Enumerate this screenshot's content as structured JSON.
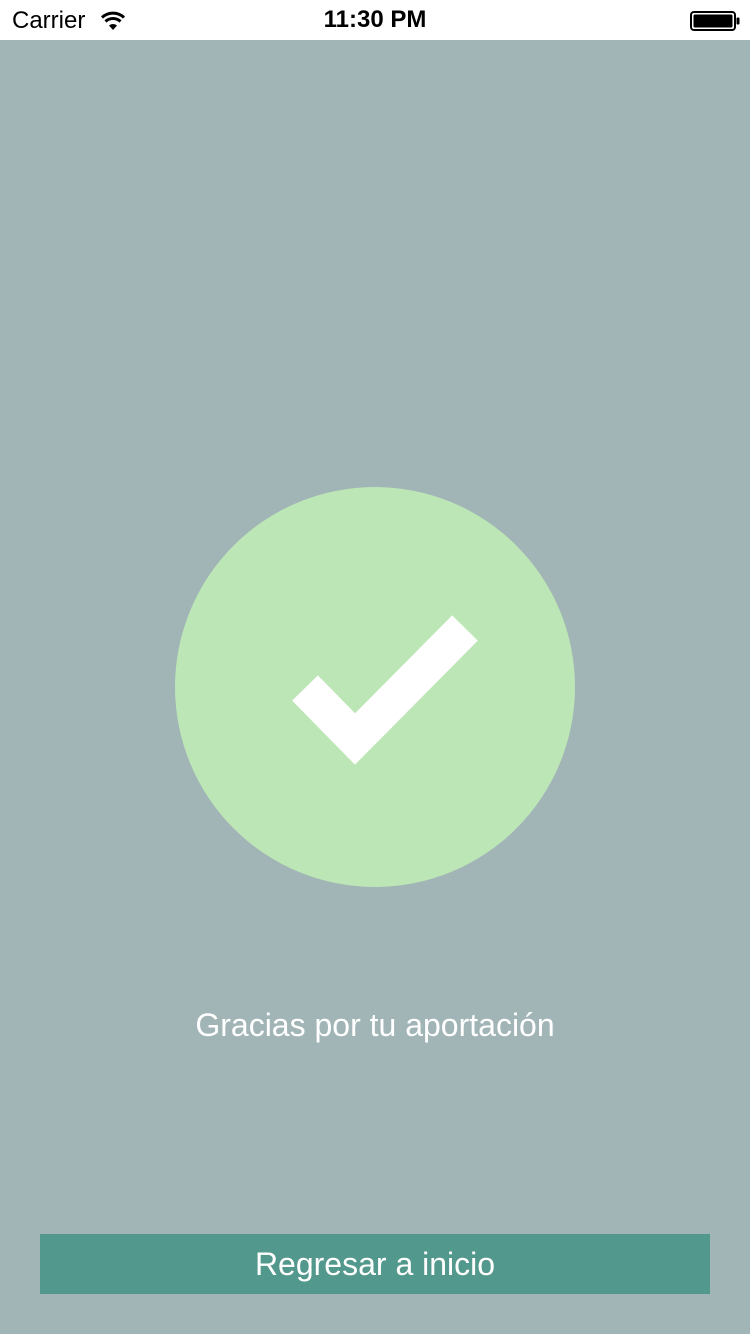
{
  "status_bar": {
    "carrier": "Carrier",
    "time": "11:30 PM",
    "wifi_icon": "wifi-icon",
    "battery_icon": "battery-full-icon"
  },
  "confirmation": {
    "icon": "checkmark-icon",
    "circle_color": "#bde6b6",
    "message": "Gracias por tu aportación"
  },
  "actions": {
    "home_label": "Regresar a inicio",
    "home_color": "#53988d"
  },
  "colors": {
    "background": "#a1b4b6"
  }
}
